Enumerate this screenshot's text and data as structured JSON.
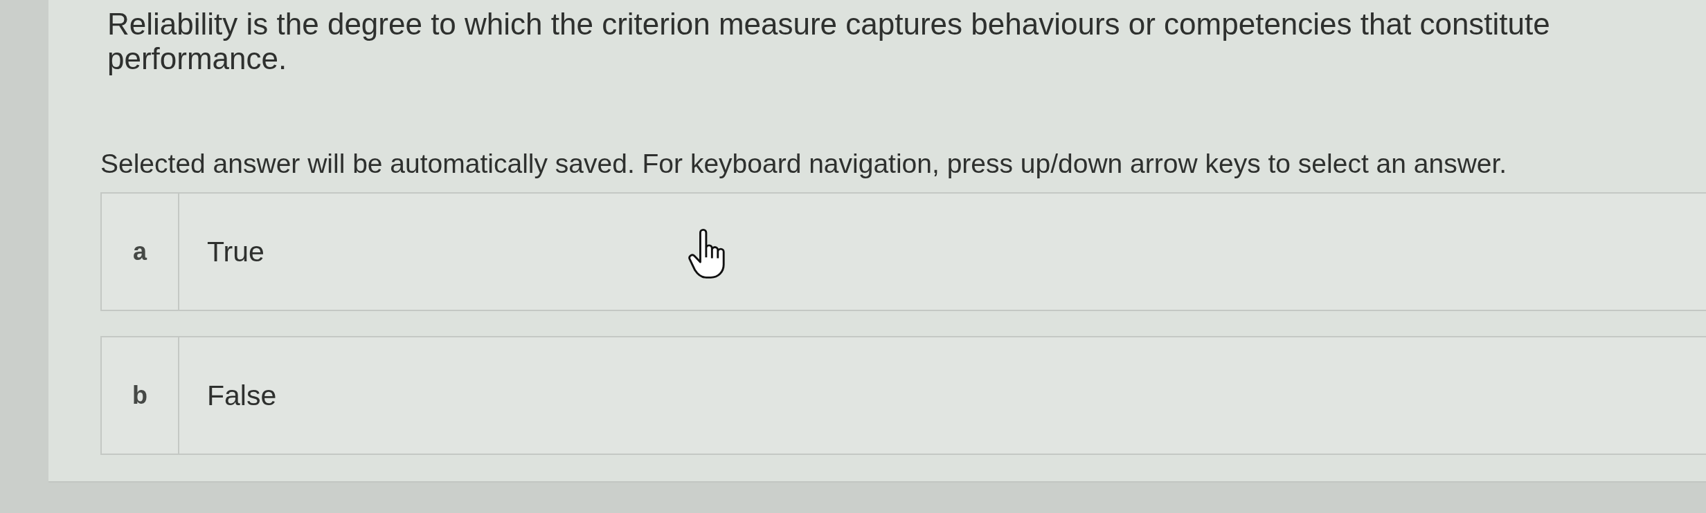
{
  "question": {
    "text": "Reliability is the degree to which the criterion measure captures behaviours or competencies that constitute performance."
  },
  "instructions": "Selected answer will be automatically saved. For keyboard navigation, press up/down arrow keys to select an answer.",
  "options": [
    {
      "letter": "a",
      "label": "True",
      "selected": false
    },
    {
      "letter": "b",
      "label": "False",
      "selected": false
    }
  ]
}
